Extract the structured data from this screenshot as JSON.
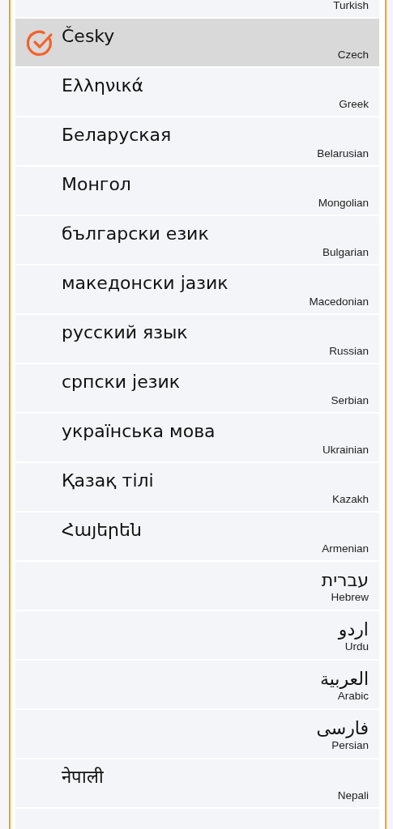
{
  "languages": [
    {
      "kind": "ltr",
      "english": "Turkish",
      "selected": false
    },
    {
      "kind": "ltr",
      "native": "Česky",
      "english": "Czech",
      "selected": true
    },
    {
      "kind": "ltr",
      "native": "Ελληνικά",
      "english": "Greek",
      "selected": false
    },
    {
      "kind": "ltr",
      "native": "Беларуская",
      "english": "Belarusian",
      "selected": false
    },
    {
      "kind": "ltr",
      "native": "Монгол",
      "english": "Mongolian",
      "selected": false
    },
    {
      "kind": "ltr",
      "native": "български език",
      "english": "Bulgarian",
      "selected": false
    },
    {
      "kind": "ltr",
      "native": "македонски јазик",
      "english": "Macedonian",
      "selected": false
    },
    {
      "kind": "ltr",
      "native": "русский язык",
      "english": "Russian",
      "selected": false
    },
    {
      "kind": "ltr",
      "native": "српски језик",
      "english": "Serbian",
      "selected": false
    },
    {
      "kind": "ltr",
      "native": "українська мова",
      "english": "Ukrainian",
      "selected": false
    },
    {
      "kind": "ltr",
      "native": "Қазақ тілі",
      "english": "Kazakh",
      "selected": false
    },
    {
      "kind": "ltr",
      "native": "Հայերեն",
      "english": "Armenian",
      "selected": false
    },
    {
      "kind": "rtl",
      "native": "עברית",
      "english": "Hebrew",
      "selected": false
    },
    {
      "kind": "rtl",
      "native": "اردو",
      "english": "Urdu",
      "selected": false
    },
    {
      "kind": "rtl",
      "native": "العربية",
      "english": "Arabic",
      "selected": false
    },
    {
      "kind": "rtl",
      "native": "فارسی",
      "english": "Persian",
      "selected": false
    },
    {
      "kind": "ltr",
      "native": "नेपाली",
      "english": "Nepali",
      "selected": false
    },
    {
      "kind": "ltr",
      "selected": false
    }
  ]
}
